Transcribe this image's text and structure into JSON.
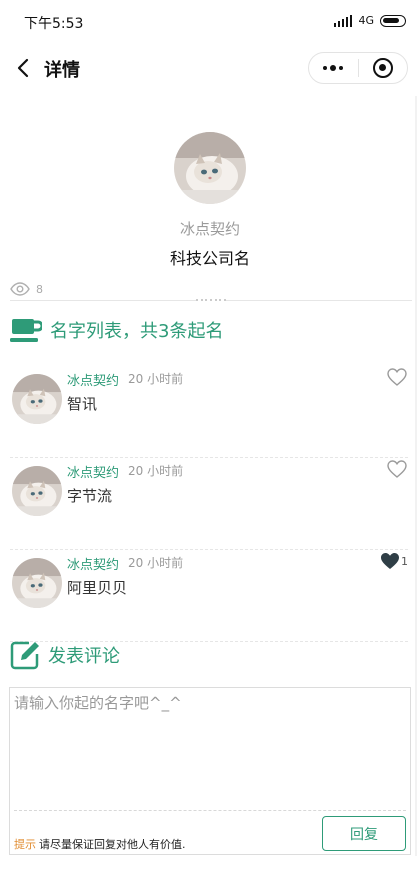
{
  "status_bar": {
    "time": "下午5:53",
    "network": "4G"
  },
  "nav": {
    "title": "详情"
  },
  "profile": {
    "author": "冰点契约",
    "company": "科技公司名",
    "views": "8"
  },
  "names_section": {
    "title": "名字列表，共3条起名"
  },
  "items": [
    {
      "author": "冰点契约",
      "time": "20 小时前",
      "name": "智讯",
      "liked": false,
      "likes": ""
    },
    {
      "author": "冰点契约",
      "time": "20 小时前",
      "name": "字节流",
      "liked": false,
      "likes": ""
    },
    {
      "author": "冰点契约",
      "time": "20 小时前",
      "name": "阿里贝贝",
      "liked": true,
      "likes": "1"
    }
  ],
  "comment_section": {
    "title": "发表评论",
    "placeholder": "请输入你起的名字吧^_^",
    "tip_label": "提示",
    "tip_text": "请尽量保证回复对他人有价值.",
    "reply_label": "回复"
  },
  "colors": {
    "accent": "#2e9b78",
    "tip": "#e08b2f",
    "muted": "#9a9a9a"
  },
  "icons": [
    "back-icon",
    "more-dots-icon",
    "target-icon",
    "eye-icon",
    "cup-icon",
    "heart-icon",
    "edit-icon"
  ]
}
